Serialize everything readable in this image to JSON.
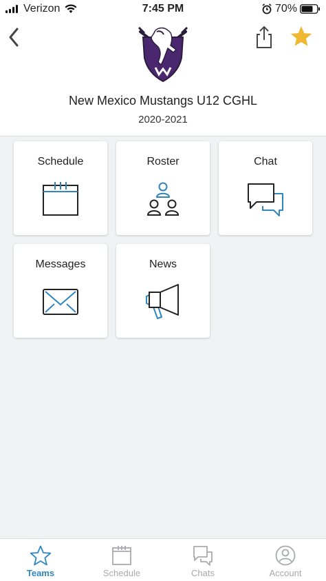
{
  "status_bar": {
    "carrier": "Verizon",
    "time": "7:45 PM",
    "battery": "70%"
  },
  "team": {
    "name": "New Mexico Mustangs U12 CGHL",
    "season": "2020-2021"
  },
  "tiles": [
    {
      "label": "Schedule"
    },
    {
      "label": "Roster"
    },
    {
      "label": "Chat"
    },
    {
      "label": "Messages"
    },
    {
      "label": "News"
    }
  ],
  "tabs": [
    {
      "label": "Teams",
      "active": true
    },
    {
      "label": "Schedule",
      "active": false
    },
    {
      "label": "Chats",
      "active": false
    },
    {
      "label": "Account",
      "active": false
    }
  ],
  "colors": {
    "accent": "#2e86c1",
    "star": "#f0b731",
    "logo_purple": "#4b2770",
    "inactive": "#a7a9ad"
  },
  "icons": {
    "back": "chevron-left-icon",
    "share": "share-icon",
    "favorite": "star-icon",
    "schedule": "calendar-icon",
    "roster": "people-icon",
    "chat": "chat-bubbles-icon",
    "messages": "envelope-icon",
    "news": "megaphone-icon",
    "account": "user-circle-icon"
  }
}
